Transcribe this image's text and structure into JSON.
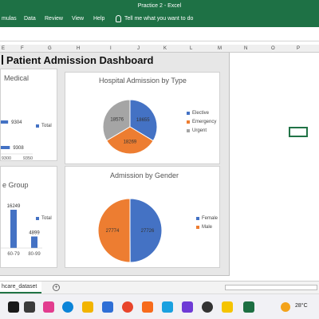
{
  "window": {
    "title": "Practice 2  -  Excel"
  },
  "menu": {
    "items": [
      "mulas",
      "Data",
      "Review",
      "View",
      "Help"
    ],
    "tell_me": "Tell me what you want to do"
  },
  "columns": [
    "E",
    "F",
    "G",
    "H",
    "I",
    "J",
    "K",
    "L",
    "M",
    "N",
    "O",
    "P"
  ],
  "dashboard": {
    "title": "Patient Admission Dashboard",
    "cards": {
      "medical": {
        "title": "Medical",
        "legend": "Total",
        "data_labels": [
          "9304",
          "9308"
        ],
        "ticks": [
          "9300",
          "9350"
        ]
      },
      "type": {
        "title": "Hospital Admission by Type"
      },
      "age": {
        "title": "e Group",
        "legend": "Total",
        "bars": [
          "60-79",
          "80-99"
        ],
        "data_labels": [
          "16249",
          "4899"
        ]
      },
      "gender": {
        "title": "Admission by Gender"
      }
    }
  },
  "chart_data": [
    {
      "type": "bar",
      "title": "Medical",
      "orientation": "horizontal",
      "series": [
        {
          "name": "Total",
          "values": [
            9304,
            9308
          ]
        }
      ],
      "xticks": [
        "9300",
        "9350"
      ],
      "color": "#4472c4"
    },
    {
      "type": "pie",
      "title": "Hospital Admission by Type",
      "categories": [
        "Elective",
        "Emergency",
        "Urgent"
      ],
      "values": [
        18655,
        18269,
        18576
      ],
      "colors": [
        "#4472c4",
        "#ed7d31",
        "#a5a5a5"
      ],
      "legend_position": "right"
    },
    {
      "type": "bar",
      "title": "e Group",
      "categories": [
        "60-79",
        "80-99"
      ],
      "series": [
        {
          "name": "Total",
          "values": [
            16249,
            4899
          ]
        }
      ],
      "color": "#4472c4"
    },
    {
      "type": "pie",
      "title": "Admission by Gender",
      "categories": [
        "Female",
        "Male"
      ],
      "values": [
        27726,
        27774
      ],
      "colors": [
        "#4472c4",
        "#ed7d31"
      ],
      "legend_position": "right"
    }
  ],
  "sheet_tabs": {
    "active": "hcare_dataset"
  },
  "tray": {
    "temperature": "28°C"
  }
}
